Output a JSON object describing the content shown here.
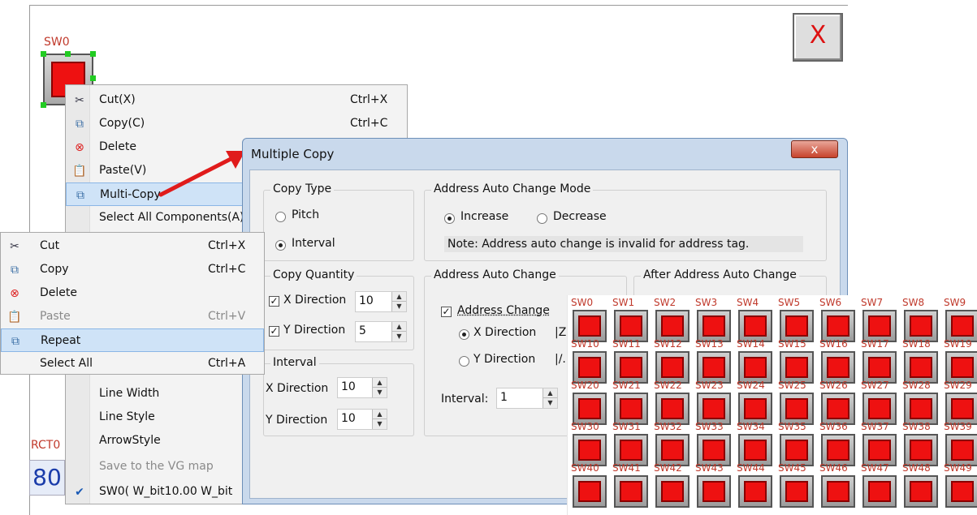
{
  "canvas": {
    "sw0_label": "SW0",
    "rct_label": "RCT0",
    "number_display": "80",
    "close_glyph": "X"
  },
  "menu_main": {
    "items": [
      {
        "label": "Cut(X)",
        "shortcut": "Ctrl+X",
        "icon": "cut-icon"
      },
      {
        "label": "Copy(C)",
        "shortcut": "Ctrl+C",
        "icon": "copy-icon"
      },
      {
        "label": "Delete",
        "shortcut": "",
        "icon": "delete-icon"
      },
      {
        "label": "Paste(V)",
        "shortcut": "",
        "icon": "paste-icon"
      },
      {
        "label": "Multi-Copy",
        "shortcut": "",
        "icon": "multi-copy-icon",
        "highlighted": true
      },
      {
        "label": "Select All Components(A)",
        "shortcut": "",
        "icon": ""
      },
      {
        "label": "Line Width",
        "shortcut": "",
        "icon": ""
      },
      {
        "label": "Line Style",
        "shortcut": "",
        "icon": ""
      },
      {
        "label": "ArrowStyle",
        "shortcut": "",
        "icon": ""
      },
      {
        "label": "Save to the VG map",
        "shortcut": "",
        "icon": "",
        "disabled": true
      },
      {
        "label": "SW0( W_bit10.00 W_bit",
        "shortcut": "",
        "icon": "check-icon"
      }
    ]
  },
  "menu_secondary": {
    "items": [
      {
        "label": "Cut",
        "shortcut": "Ctrl+X",
        "icon": "cut-icon"
      },
      {
        "label": "Copy",
        "shortcut": "Ctrl+C",
        "icon": "copy-icon"
      },
      {
        "label": "Delete",
        "shortcut": "",
        "icon": "delete-icon"
      },
      {
        "label": "Paste",
        "shortcut": "Ctrl+V",
        "icon": "paste-icon",
        "disabled": true
      },
      {
        "label": "Repeat",
        "shortcut": "",
        "icon": "repeat-icon",
        "highlighted": true
      },
      {
        "label": "Select All",
        "shortcut": "Ctrl+A",
        "icon": ""
      }
    ]
  },
  "dialog": {
    "title": "Multiple Copy",
    "close_glyph": "x",
    "copy_type": {
      "title": "Copy Type",
      "options": [
        "Pitch",
        "Interval"
      ],
      "selected": "Interval"
    },
    "auto_change_mode": {
      "title": "Address Auto Change Mode",
      "options": [
        "Increase",
        "Decrease"
      ],
      "selected": "Increase",
      "note": "Note: Address auto change is invalid for address tag."
    },
    "copy_quantity": {
      "title": "Copy Quantity",
      "x_label": "X Direction",
      "x_value": "10",
      "x_checked": true,
      "y_label": "Y Direction",
      "y_value": "5",
      "y_checked": true
    },
    "interval": {
      "title": "Interval",
      "x_label": "X Direction",
      "x_value": "10",
      "y_label": "Y Direction",
      "y_value": "10"
    },
    "address_auto_change": {
      "title": "Address Auto Change",
      "checkbox_label": "Address Change",
      "checked": true,
      "options": [
        "X Direction",
        "Y Direction"
      ],
      "selected": "X Direction",
      "interval_label": "Interval:",
      "interval_value": "1",
      "glyph_x": "|Z",
      "glyph_y": "|/."
    },
    "after_change": {
      "title": "After Address Auto Change"
    }
  },
  "grid": {
    "labels": [
      "SW0",
      "SW1",
      "SW2",
      "SW3",
      "SW4",
      "SW5",
      "SW6",
      "SW7",
      "SW8",
      "SW9",
      "SW10",
      "SW11",
      "SW12",
      "SW13",
      "SW14",
      "SW15",
      "SW16",
      "SW17",
      "SW18",
      "SW19",
      "SW20",
      "SW21",
      "SW22",
      "SW23",
      "SW24",
      "SW25",
      "SW26",
      "SW27",
      "SW28",
      "SW29",
      "SW30",
      "SW31",
      "SW32",
      "SW33",
      "SW34",
      "SW35",
      "SW36",
      "SW37",
      "SW38",
      "SW39",
      "SW40",
      "SW41",
      "SW42",
      "SW43",
      "SW44",
      "SW45",
      "SW46",
      "SW47",
      "SW48",
      "SW49"
    ],
    "columns": 10,
    "rows": 5
  },
  "colors": {
    "accent_red": "#ee1111",
    "label_red": "#c0392b",
    "highlight": "#cfe3f7",
    "dialog_frame": "#c9d9ec"
  }
}
